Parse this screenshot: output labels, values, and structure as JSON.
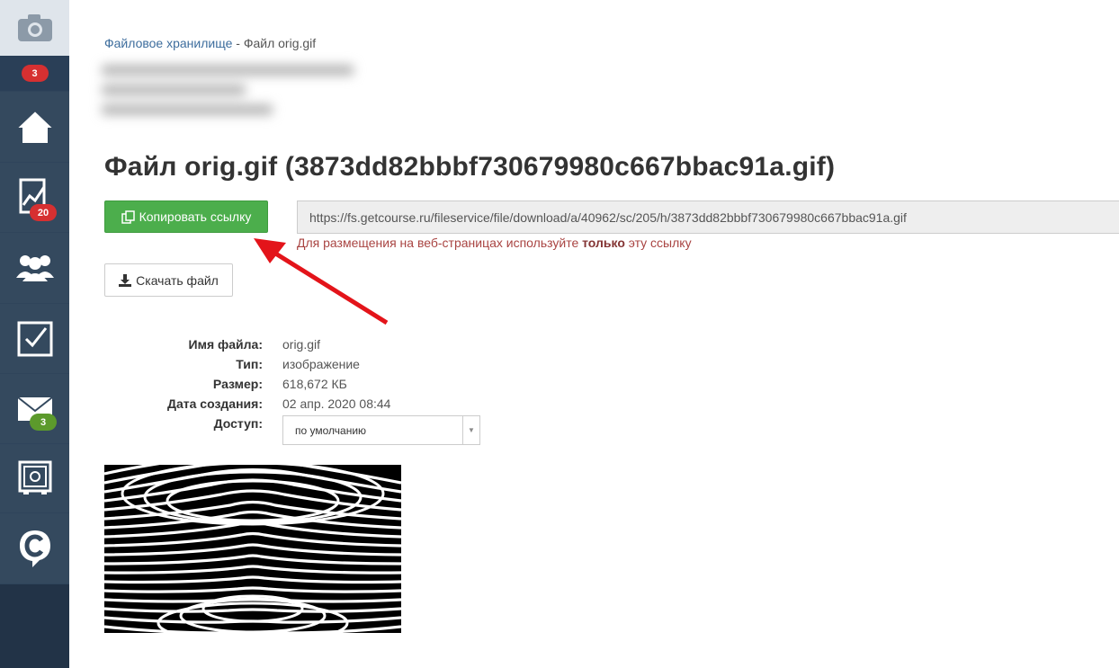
{
  "sidebar": {
    "badges": {
      "notifications": "3",
      "analytics": "20",
      "messages": "3"
    },
    "icons": [
      "camera-icon",
      "home-icon",
      "chart-icon",
      "users-icon",
      "tasks-icon",
      "mail-icon",
      "safe-icon",
      "chat-logo-icon"
    ]
  },
  "breadcrumb": {
    "link": "Файловое хранилище",
    "separator": "-",
    "current": "Файл orig.gif"
  },
  "page": {
    "title": "Файл orig.gif (3873dd82bbbf730679980c667bbac91a.gif)"
  },
  "copy_link": {
    "button_label": "Копировать ссылку",
    "url": "https://fs.getcourse.ru/fileservice/file/download/a/40962/sc/205/h/3873dd82bbbf730679980c667bbac91a.gif",
    "note_before": "Для размещения на веб-страницах используйте ",
    "note_bold": "только",
    "note_after": " эту ссылку"
  },
  "download": {
    "button_label": "Скачать файл"
  },
  "properties": {
    "filename_label": "Имя файла:",
    "filename_value": "orig.gif",
    "type_label": "Тип:",
    "type_value": "изображение",
    "size_label": "Размер:",
    "size_value": "618,672 КБ",
    "created_label": "Дата создания:",
    "created_value": "02 апр. 2020 08:44",
    "access_label": "Доступ:",
    "access_value": "по умолчанию"
  },
  "colors": {
    "sidebar_bg": "#223347",
    "primary_green": "#4cae4c",
    "badge_red": "#d63031",
    "badge_green": "#5c9a2c",
    "link_blue": "#3d6d9d",
    "note_red": "#a94442",
    "annotation_arrow": "#e3141a"
  }
}
